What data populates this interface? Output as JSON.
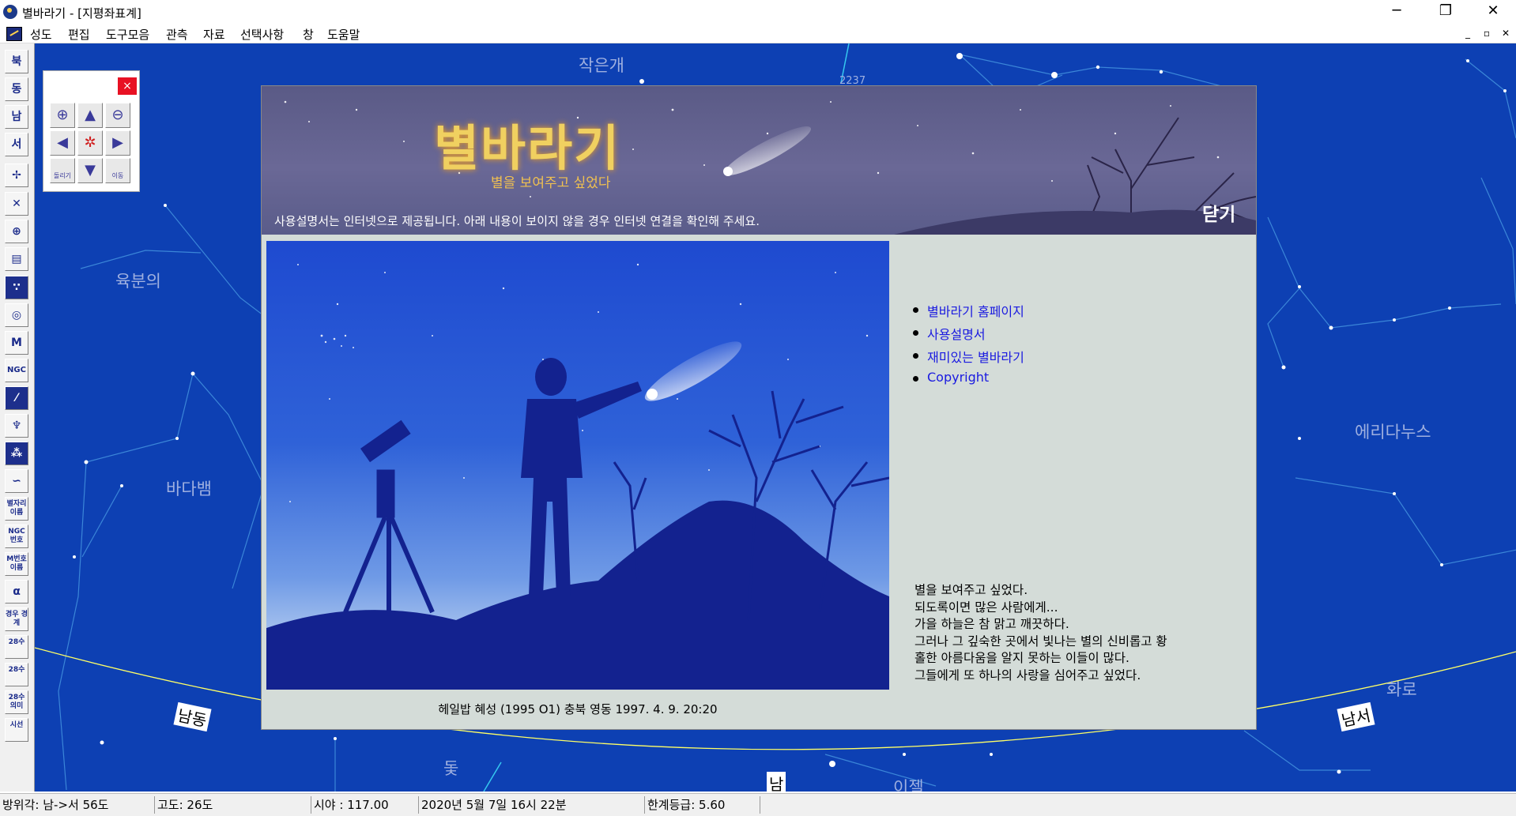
{
  "window": {
    "title": "별바라기 - [지평좌표계]",
    "minimize": "─",
    "maximize": "❐",
    "close": "✕"
  },
  "menu": {
    "items": [
      "성도",
      "편집",
      "도구모음",
      "관측",
      "자료",
      "선택사항",
      "창",
      "도움말"
    ],
    "mdi_min": "_",
    "mdi_restore": "▫",
    "mdi_close": "✕"
  },
  "toolbar": {
    "buttons": [
      "북",
      "동",
      "남",
      "서",
      "",
      "",
      "",
      "",
      "",
      "",
      "M",
      "NGC",
      "",
      "",
      "",
      "",
      "별자리 이름",
      "NGC 번호",
      "M번호 이름",
      "α",
      "경우 경계",
      "28수",
      "28수",
      "28수 의미",
      "시선"
    ]
  },
  "sky": {
    "background": "#0d40b3",
    "constellations": [
      "작은개",
      "육분의",
      "바다뱀",
      "에리다누스",
      "화로",
      "돛",
      "이젤"
    ],
    "horizon_labels": [
      "남동",
      "남서",
      "남"
    ],
    "faint_text": "2237"
  },
  "nav_palette": {
    "close": "×",
    "buttons": [
      "zoom-in",
      "up",
      "zoom-out",
      "left",
      "center",
      "right",
      "rotate",
      "down",
      "move"
    ],
    "rotate_label": "돌리기",
    "move_label": "이동"
  },
  "welcome": {
    "banner_title": "별바라기",
    "banner_subtitle": "별을 보여주고 싶었다",
    "notice": "사용설명서는 인터넷으로 제공됩니다. 아래 내용이 보이지 않을 경우 인터넷 연결을 확인해 주세요.",
    "close_label": "닫기",
    "links": [
      "별바라기 홈페이지",
      "사용설명서",
      "재미있는 별바라기",
      "Copyright"
    ],
    "poem": [
      "별을 보여주고 싶었다.",
      "되도록이면 많은 사람에게...",
      "가을 하늘은 참 맑고 깨끗하다.",
      "그러나 그 깊숙한 곳에서 빛나는 별의 신비롭고 황",
      "홀한 아름다움을 알지 못하는 이들이 많다.",
      "그들에게 또 하나의 사랑을 심어주고 싶었다."
    ],
    "caption": "헤일밥 혜성 (1995 O1) 충북 영동 1997. 4. 9. 20:20"
  },
  "status": {
    "azimuth": "방위각: 남->서  56도",
    "altitude": "고도:   26도",
    "fov": "시야 : 117.00",
    "datetime": "2020년  5월  7일 16시 22분",
    "limit_mag": "한계등급:  5.60"
  }
}
